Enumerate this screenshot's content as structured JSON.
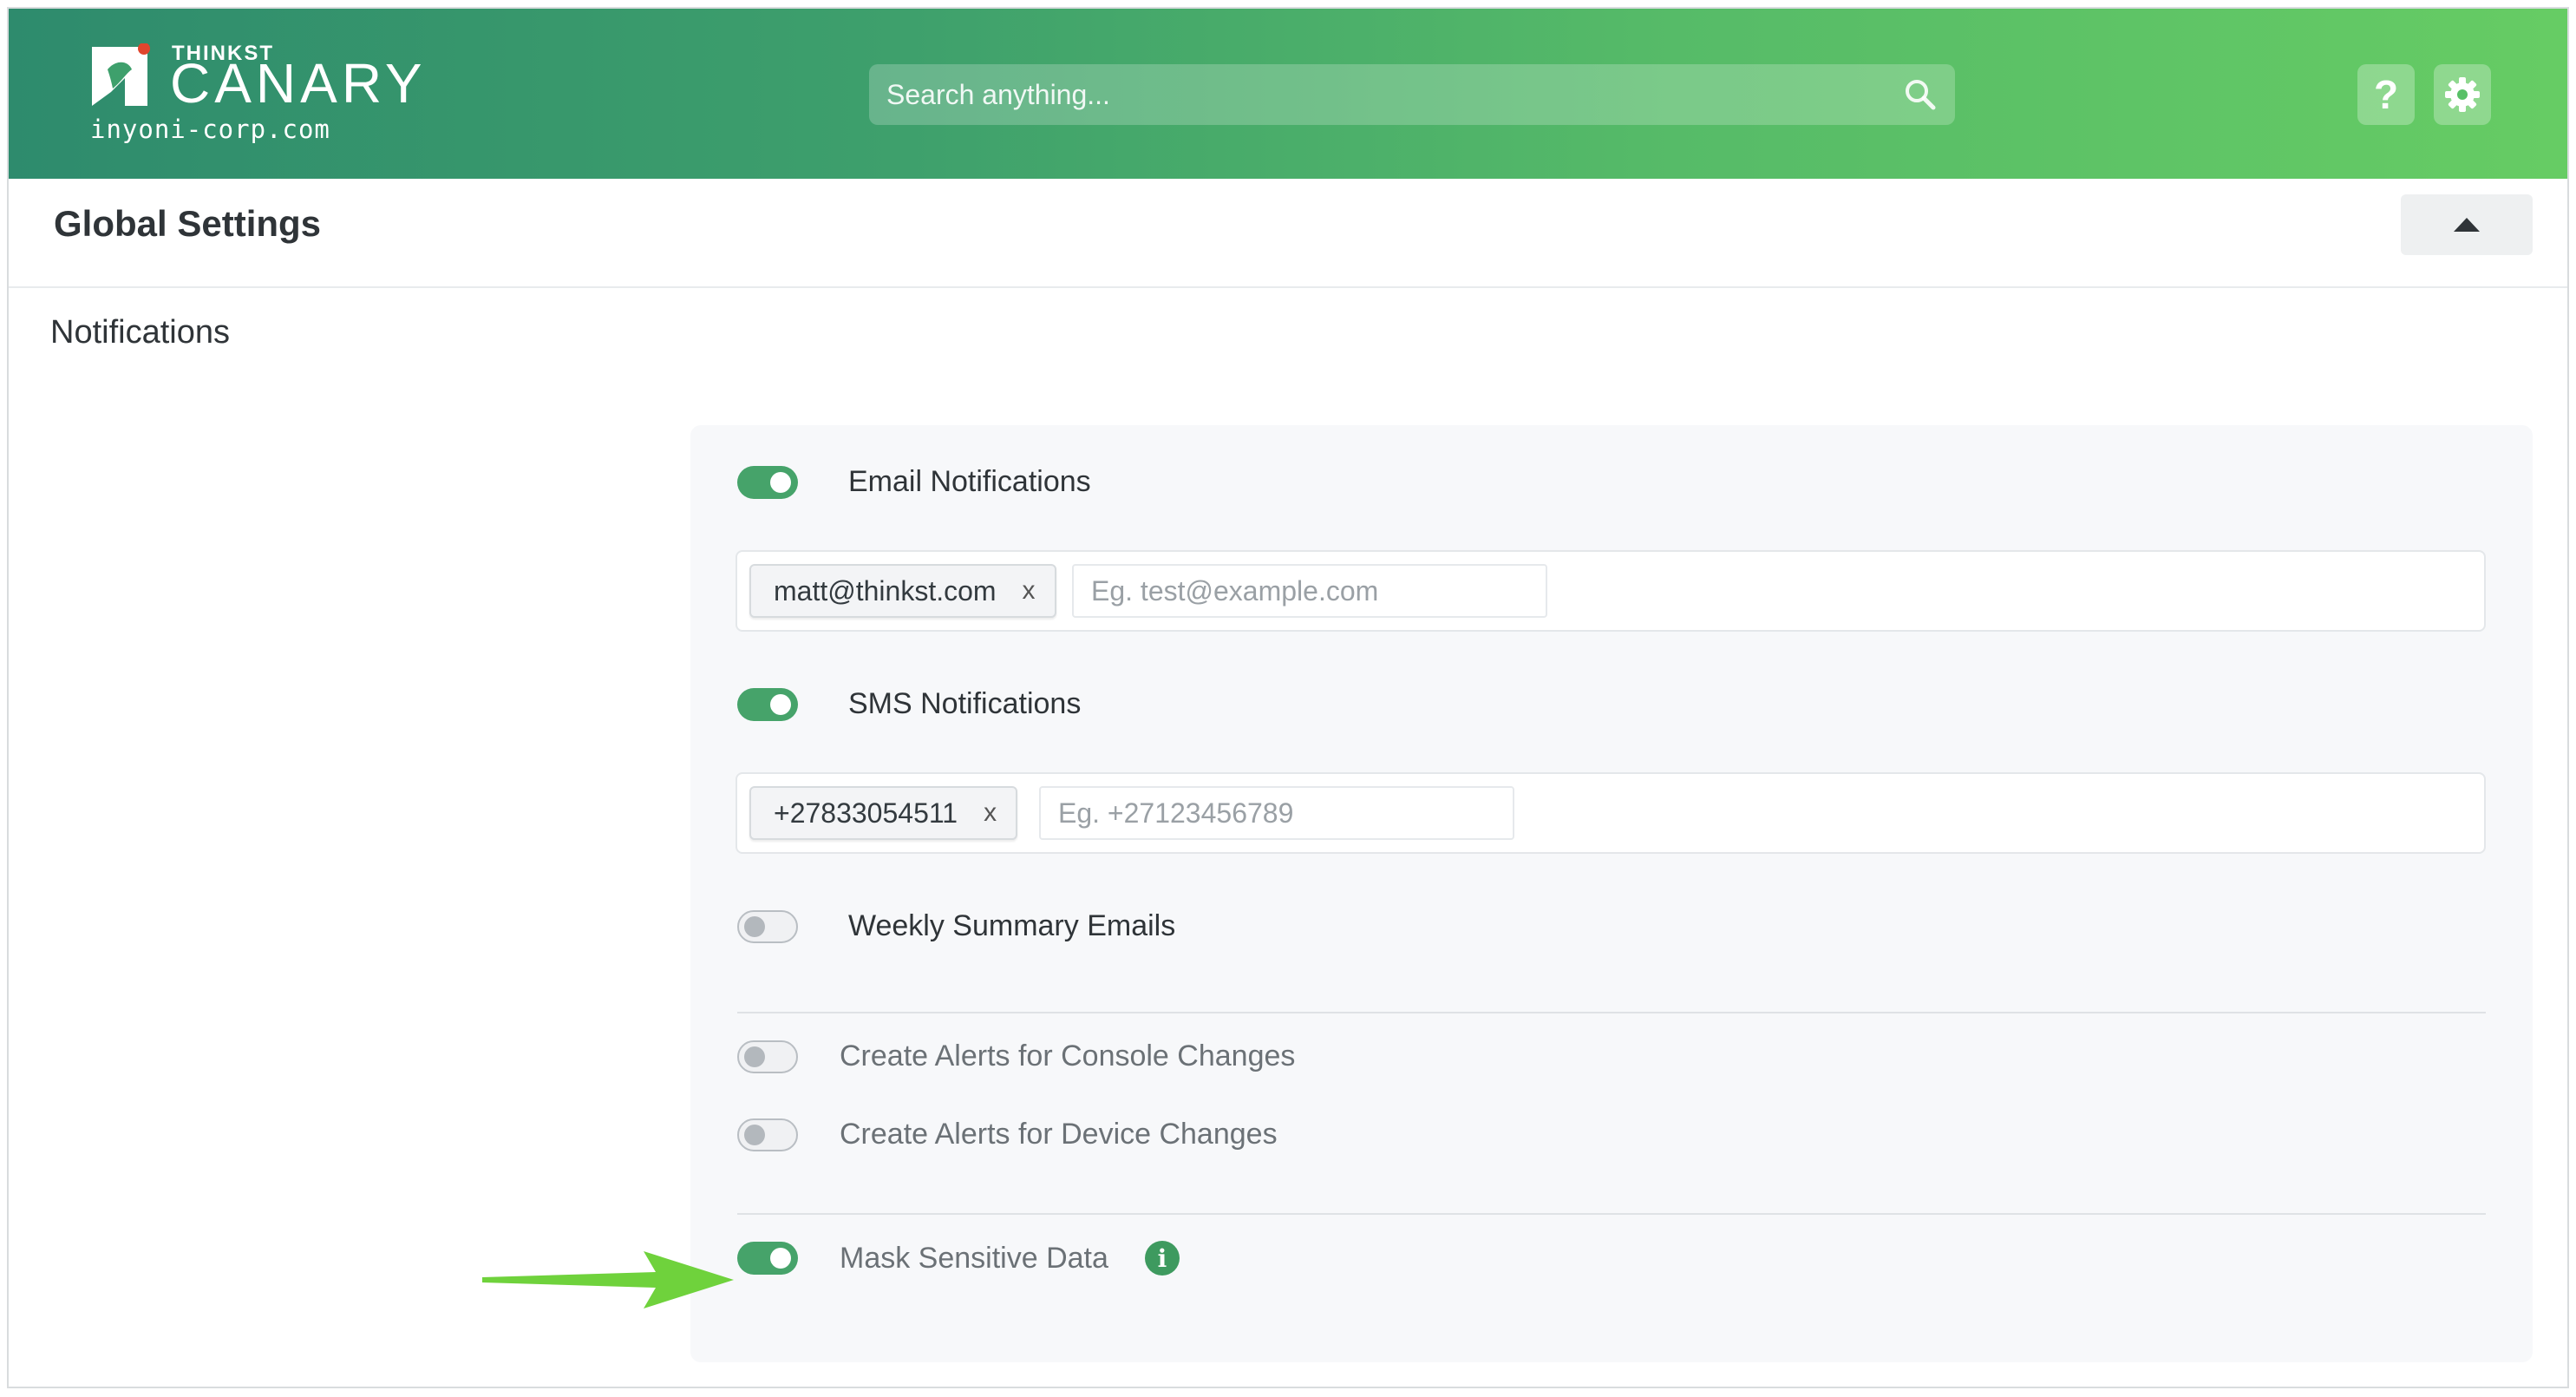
{
  "header": {
    "brand_small": "THINKST",
    "brand_name": "CANARY",
    "domain": "inyoni-corp.com",
    "search_placeholder": "Search anything...",
    "help_label": "?",
    "icons": {
      "search": "search-icon",
      "help": "question-icon",
      "settings": "gear-icon"
    }
  },
  "page": {
    "title": "Global Settings"
  },
  "section": {
    "title": "Notifications"
  },
  "notifications": {
    "email": {
      "label": "Email Notifications",
      "enabled": true,
      "tags": [
        "matt@thinkst.com"
      ],
      "remove_label": "x",
      "placeholder": "Eg. test@example.com"
    },
    "sms": {
      "label": "SMS Notifications",
      "enabled": true,
      "tags": [
        "+27833054511"
      ],
      "remove_label": "x",
      "placeholder": "Eg. +27123456789"
    },
    "weekly_summary": {
      "label": "Weekly Summary Emails",
      "enabled": false
    },
    "console_changes": {
      "label": "Create Alerts for Console Changes",
      "enabled": false
    },
    "device_changes": {
      "label": "Create Alerts for Device Changes",
      "enabled": false
    },
    "mask_sensitive": {
      "label": "Mask Sensitive Data",
      "enabled": true,
      "info_glyph": "i"
    }
  },
  "colors": {
    "header_gradient_start": "#2e8b6d",
    "header_gradient_end": "#66cc64",
    "toggle_on": "#46a36a",
    "callout_arrow": "#6fd23c"
  }
}
